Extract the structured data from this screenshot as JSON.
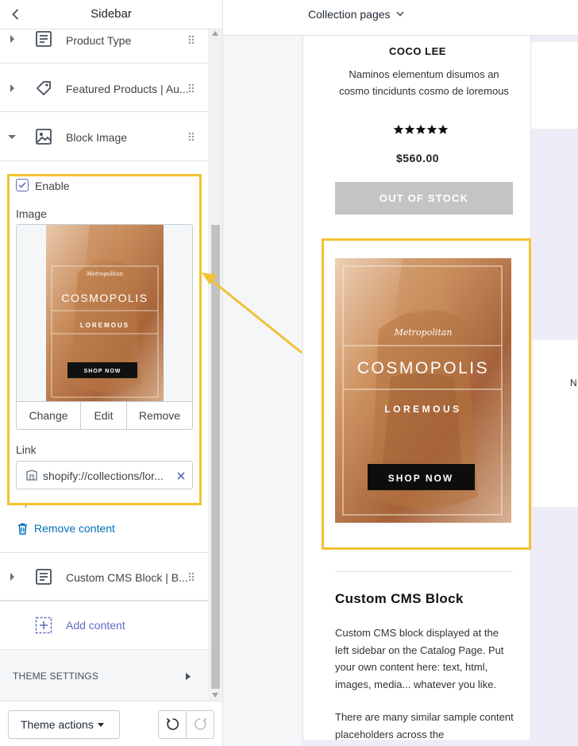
{
  "sidebar": {
    "title": "Sidebar",
    "sections": [
      {
        "label": "Product Type",
        "icon": "text-block-icon"
      },
      {
        "label": "Featured Products | Au...",
        "icon": "tag-icon"
      },
      {
        "label": "Block Image",
        "icon": "image-icon"
      },
      {
        "label": "Custom CMS Block | B...",
        "icon": "text-block-icon"
      }
    ],
    "block_image": {
      "enable_label": "Enable",
      "enable_checked": true,
      "image_label": "Image",
      "actions": [
        "Change",
        "Edit",
        "Remove"
      ],
      "link_label": "Link",
      "link_value": "shopify://collections/lor...",
      "link_help": "Optional",
      "banner": {
        "script_text": "Metropolitan",
        "headline": "COSMOPOLIS",
        "subline": "LOREMOUS",
        "button": "SHOP NOW"
      }
    },
    "remove_content": "Remove content",
    "add_content": "Add content",
    "theme_settings": "THEME SETTINGS",
    "footer": {
      "theme_actions": "Theme actions"
    }
  },
  "preview": {
    "page_select": "Collection pages",
    "product": {
      "vendor": "COCO LEE",
      "description": "Naminos elementum disumos an cosmo tincidunts cosmo de loremous",
      "rating": 5,
      "price": "$560.00",
      "stock_button": "OUT OF STOCK"
    },
    "banner": {
      "script_text": "Metropolitan",
      "headline": "COSMOPOLIS",
      "subline": "LOREMOUS",
      "button": "SHOP NOW"
    },
    "cms": {
      "title": "Custom CMS Block",
      "paragraph1": "Custom CMS block displayed at the left sidebar on the Catalog Page. Put your own content here: text, html, images, media... whatever you like.",
      "paragraph2": "There are many similar sample content placeholders across the"
    },
    "right_edge_text": "N"
  },
  "colors": {
    "highlight": "#f2c230",
    "accent_blue": "#006fbb",
    "indigo": "#5c6ac4",
    "out_of_stock_bg": "#c4c4c4"
  }
}
